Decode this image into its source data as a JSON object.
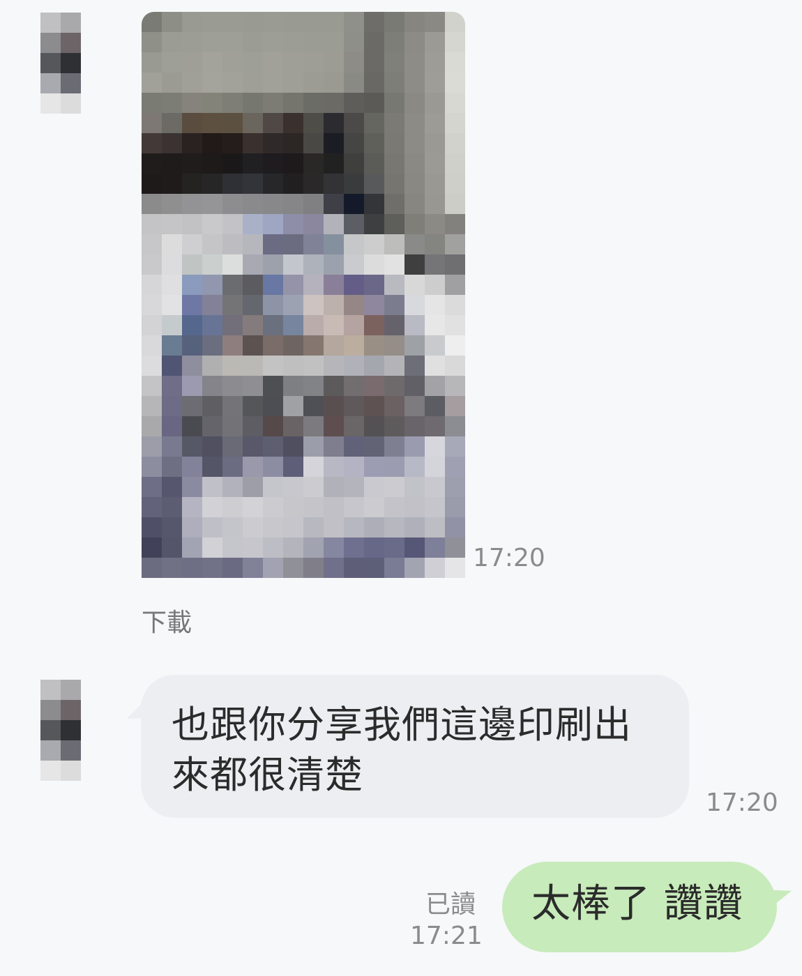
{
  "colors": {
    "background": "#f7f8fa",
    "incoming_bubble": "#eceef1",
    "outgoing_bubble": "#c7ebba",
    "meta_text": "#8b8b8b"
  },
  "messages": [
    {
      "type": "image",
      "sender": "other",
      "avatar": "pixelated-avatar",
      "image_description_icon": "pixelated-photo",
      "time": "17:20",
      "download_label": "下載"
    },
    {
      "type": "text",
      "sender": "other",
      "avatar": "pixelated-avatar",
      "text": "也跟你分享我們這邊印刷出來都很清楚",
      "time": "17:20"
    },
    {
      "type": "text",
      "sender": "me",
      "text": "太棒了 讚讚",
      "read_status": "已讀",
      "time": "17:21"
    }
  ],
  "avatar_pixels": [
    "#c0c0c3",
    "#a9a9ac",
    "#8c8c8e",
    "#6c6466",
    "#56575a",
    "#2f3034",
    "#a9a9b0",
    "#6b6b74",
    "#e6e6e6",
    "#dcdcdc"
  ],
  "photo_pixels": [
    [
      "#7a7b74",
      "#8d8e86",
      "#999a92",
      "#9a9b93",
      "#9a9b93",
      "#999a92",
      "#9a9b93",
      "#999a92",
      "#999a92",
      "#999a92",
      "#8f9089",
      "#6f6d69",
      "#7a7a74",
      "#86857f",
      "#8a8984",
      "#d2d2cc"
    ],
    [
      "#8f9088",
      "#9b9c94",
      "#9c9d95",
      "#9e9f97",
      "#9e9f97",
      "#9b9c94",
      "#9d9e96",
      "#9c9d95",
      "#9b9c94",
      "#9b9c94",
      "#8e8f88",
      "#6c6a67",
      "#7e7e78",
      "#8c8b85",
      "#9b9a94",
      "#d6d6d0"
    ],
    [
      "#999a92",
      "#9e9f97",
      "#a09f97",
      "#a3a39b",
      "#a0a098",
      "#9e9f97",
      "#a1a199",
      "#9f9f97",
      "#9e9e96",
      "#9c9c94",
      "#8d8c86",
      "#6c6a67",
      "#80807a",
      "#8d8c86",
      "#9d9c96",
      "#dadad4"
    ],
    [
      "#a1a199",
      "#9b9b93",
      "#a0a098",
      "#a4a49c",
      "#a2a29a",
      "#9f9f97",
      "#a1a199",
      "#9f9f97",
      "#9c9c94",
      "#9a9a92",
      "#8a8a84",
      "#6a6865",
      "#7e7e78",
      "#8d8c86",
      "#9e9d97",
      "#dbdbd5"
    ],
    [
      "#7a7c74",
      "#7c7e76",
      "#85837b",
      "#838379",
      "#7e7e76",
      "#76776f",
      "#7c7c74",
      "#75756d",
      "#6c6c66",
      "#6b6a65",
      "#5f5d5a",
      "#5c5a57",
      "#787872",
      "#8a8983",
      "#9a9993",
      "#d8d8d2"
    ],
    [
      "#7d7874",
      "#6b6a64",
      "#5a4c3f",
      "#5e5040",
      "#5c5140",
      "#6a665e",
      "#4f4845",
      "#3a302e",
      "#4f4d48",
      "#2c2b30",
      "#4b4a49",
      "#656660",
      "#7b7a74",
      "#8c8b85",
      "#9c9b95",
      "#d5d5cf"
    ],
    [
      "#433a38",
      "#3b3332",
      "#2a2221",
      "#211a18",
      "#241d1b",
      "#3a302e",
      "#30292a",
      "#2c2625",
      "#4a4845",
      "#1c1c24",
      "#454543",
      "#5f605a",
      "#7a7973",
      "#8c8b85",
      "#9a9993",
      "#d2d2cc"
    ],
    [
      "#201c1c",
      "#1f1b1a",
      "#201c1c",
      "#1e1a1a",
      "#1a1818",
      "#202023",
      "#1e1c1e",
      "#1e1a1b",
      "#2a2727",
      "#222122",
      "#3f3f3e",
      "#5b5c57",
      "#787771",
      "#8a8983",
      "#9b9a94",
      "#d0d0ca"
    ],
    [
      "#1e1a19",
      "#1f1b1b",
      "#252322",
      "#272627",
      "#2f3035",
      "#33343a",
      "#27272a",
      "#221f20",
      "#2a2828",
      "#333336",
      "#3a3b3c",
      "#58595a",
      "#767570",
      "#898882",
      "#999892",
      "#cfcfc9"
    ],
    [
      "#8b8b8b",
      "#8f8f90",
      "#939395",
      "#959597",
      "#8d8d8f",
      "#8a8a8c",
      "#88888a",
      "#868688",
      "#808082",
      "#3f4047",
      "#141a2a",
      "#333538",
      "#6f6e6a",
      "#878680",
      "#989791",
      "#cdcdc7"
    ],
    [
      "#c4c4c6",
      "#c5c5c8",
      "#c2c2c5",
      "#c9c9cc",
      "#c3c3c7",
      "#a9b1c9",
      "#9fa6c3",
      "#8e8ea8",
      "#8a879e",
      "#b2b2bb",
      "#5c5e66",
      "#3e3f41",
      "#5e5e5b",
      "#7f7e79",
      "#8b8a85",
      "#82817e"
    ],
    [
      "#c7c7c9",
      "#dcdcdd",
      "#cfcfd2",
      "#c5c5c8",
      "#bdbdc1",
      "#b6b6bd",
      "#6c6b84",
      "#6c6c80",
      "#808298",
      "#85909f",
      "#c5c7c9",
      "#cdcdcd",
      "#bdbdbc",
      "#8a8a88",
      "#848480",
      "#a1a19f"
    ],
    [
      "#c9c9cb",
      "#dcdcde",
      "#c0c4c2",
      "#cbd0ce",
      "#dcdedd",
      "#a7a9b3",
      "#9ca1ac",
      "#c4c6cd",
      "#aeb2ba",
      "#9ba1ad",
      "#cacbcf",
      "#dcdcdc",
      "#e2e2e2",
      "#3f3f40",
      "#757578",
      "#6f6f72"
    ],
    [
      "#d6d6d8",
      "#dfdfe2",
      "#8a9bbd",
      "#9197ae",
      "#6b6c70",
      "#5c5b5f",
      "#6877a3",
      "#9593a8",
      "#b5b2be",
      "#8a7f99",
      "#635d87",
      "#6a6788",
      "#b9bac0",
      "#d8d8d9",
      "#cdcdce",
      "#a0a0a2"
    ],
    [
      "#d8d8da",
      "#e2e2e5",
      "#6f78a5",
      "#838198",
      "#747476",
      "#65676e",
      "#8d94a6",
      "#9da2b3",
      "#cdc3c1",
      "#bdb1ad",
      "#958786",
      "#8e879d",
      "#7b7d8f",
      "#d8d9dc",
      "#e5e5e5",
      "#dbdbdc"
    ],
    [
      "#d3d3d5",
      "#c5cacd",
      "#56678e",
      "#677495",
      "#726e7a",
      "#847b7c",
      "#6b707e",
      "#77859e",
      "#b9acaa",
      "#c8bab5",
      "#b4a3a0",
      "#7c625f",
      "#66626c",
      "#b9bac3",
      "#e7e7e8",
      "#e1e1e2"
    ],
    [
      "#d9d9db",
      "#6a7c92",
      "#56617c",
      "#6a6e7e",
      "#8e7e7d",
      "#5c5250",
      "#7a6c69",
      "#6e6562",
      "#85776f",
      "#b4a79d",
      "#bcae9f",
      "#9a8f84",
      "#948d88",
      "#9ea1a5",
      "#c9cacd",
      "#eeeeee"
    ],
    [
      "#dcdcde",
      "#4f5573",
      "#8e8e9e",
      "#b0b0b0",
      "#bbb9b3",
      "#bab9b6",
      "#c3c3c3",
      "#c0bfbf",
      "#c2c1c2",
      "#b6b5b9",
      "#b0b1b9",
      "#a5a7ae",
      "#b4b4b8",
      "#6d6e78",
      "#e0e0e1",
      "#d9d9da"
    ],
    [
      "#c4c4c6",
      "#6f6d87",
      "#9b9ab0",
      "#84848a",
      "#8c8c90",
      "#8f8f93",
      "#4e4f52",
      "#7e7f83",
      "#828387",
      "#5c5a5a",
      "#726e6f",
      "#7a6c6e",
      "#6e6a6c",
      "#606066",
      "#a2a2a7",
      "#b7b7b9"
    ],
    [
      "#b6b6b8",
      "#6d6b86",
      "#6c6c72",
      "#5f5f63",
      "#747478",
      "#55565a",
      "#4d4e53",
      "#a0a1a5",
      "#4f5055",
      "#5a4f50",
      "#5f595b",
      "#5e5253",
      "#6c6162",
      "#7d7b7e",
      "#5c5c63",
      "#a59d9f"
    ],
    [
      "#a9a9ab",
      "#686682",
      "#4a4b51",
      "#64646a",
      "#727277",
      "#5d5d63",
      "#56494a",
      "#6a6365",
      "#7d7a7f",
      "#5e4e50",
      "#6a6567",
      "#535153",
      "#5e5b5d",
      "#696469",
      "#6e6a6f",
      "#8c8c93"
    ],
    [
      "#9d9daa",
      "#797a90",
      "#575866",
      "#505060",
      "#696a76",
      "#58586a",
      "#5d5e70",
      "#4f4f60",
      "#9c9daa",
      "#7e7e8e",
      "#61627a",
      "#626374",
      "#7e7f91",
      "#9a9bae",
      "#d6d6dc",
      "#a8a9b8"
    ],
    [
      "#8c8d9e",
      "#6e6f82",
      "#82839a",
      "#545567",
      "#6b6c82",
      "#9999ab",
      "#8c8ca2",
      "#5e5e78",
      "#d4d4da",
      "#b8b8c4",
      "#b3b3c4",
      "#9c9db3",
      "#9b9cb0",
      "#b8b9c6",
      "#d4d4db",
      "#9fa0b2"
    ],
    [
      "#6e6f86",
      "#56576e",
      "#8a8ba1",
      "#c0c0c8",
      "#b2b2bd",
      "#9e9ea9",
      "#c5c5cc",
      "#c7c7cd",
      "#cbcbd0",
      "#b1b1ba",
      "#b4b4bd",
      "#c9c9cf",
      "#cbcbd0",
      "#c2c2c9",
      "#c8c8ce",
      "#9e9fae"
    ],
    [
      "#62637a",
      "#5c5c73",
      "#b4b4c2",
      "#d1d1d6",
      "#cecdd2",
      "#d2d2d7",
      "#cbcbd0",
      "#c6c6cb",
      "#c4c4c9",
      "#c0c0c6",
      "#c6c6cc",
      "#cbcbd0",
      "#c3c3c9",
      "#c1c1c7",
      "#c5c5cb",
      "#9a9bab"
    ],
    [
      "#4f5068",
      "#56566d",
      "#aeaebc",
      "#bfbfc8",
      "#c4c4cb",
      "#cbcbd0",
      "#c7c7cc",
      "#c5c5cb",
      "#b8b8c0",
      "#c0c0c6",
      "#b7b7bf",
      "#aeaeb8",
      "#b7b7c0",
      "#b0b0ba",
      "#bdbdc4",
      "#9192a5"
    ],
    [
      "#414259",
      "#545569",
      "#a3a4b3",
      "#d1d1d6",
      "#c5c5cc",
      "#c6c6cc",
      "#bdbdc5",
      "#b4b4bd",
      "#a2a3b0",
      "#8586a0",
      "#6f7090",
      "#676888",
      "#6a6b89",
      "#565777",
      "#7e7f98",
      "#909198"
    ],
    [
      "#6b6c80",
      "#707185",
      "#6e6f85",
      "#717288",
      "#6a6b82",
      "#818298",
      "#a2a3b2",
      "#909098",
      "#807f89",
      "#70708a",
      "#5e5e78",
      "#5d5e78",
      "#7a7b94",
      "#a3a4b2",
      "#cfcfd5",
      "#e5e5e7"
    ]
  ]
}
